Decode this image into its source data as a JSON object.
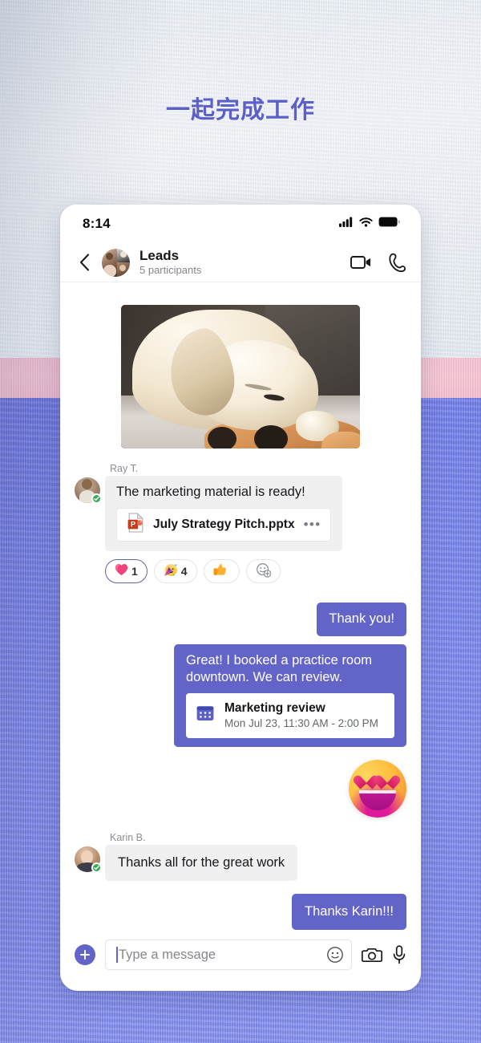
{
  "page": {
    "headline": "一起完成工作",
    "accent_color": "#5b5fc7",
    "bubble_out_color": "#6264c8",
    "background_bands": [
      "#e8ecf2",
      "#f3bfd0",
      "#7a86ea"
    ]
  },
  "statusbar": {
    "time": "8:14",
    "icons": [
      "cellular-signal-icon",
      "wifi-icon",
      "battery-icon"
    ]
  },
  "header": {
    "back_icon": "back-chevron-icon",
    "avatar": "group-avatar",
    "title": "Leads",
    "subtitle": "5 participants",
    "actions": [
      {
        "icon": "video-call-icon",
        "label": "Video call"
      },
      {
        "icon": "audio-call-icon",
        "label": "Audio call"
      }
    ]
  },
  "messages": [
    {
      "type": "photo",
      "name": "photo-message",
      "alt": "Sleeping yellow labrador resting on a plush toy"
    },
    {
      "type": "incoming",
      "sender": "Ray T.",
      "presence": "available",
      "text": "The marketing material is ready!",
      "attachment": {
        "icon": "powerpoint-file-icon",
        "name": "July Strategy Pitch.pptx",
        "more_label": "•••"
      },
      "reactions": [
        {
          "emoji": "❤️",
          "name": "heart-reaction",
          "count": "1",
          "selected": true
        },
        {
          "emoji": "🥳",
          "name": "party-face-reaction",
          "count": "4",
          "selected": false
        },
        {
          "emoji": "👍",
          "name": "thumbs-up-reaction",
          "count": "",
          "selected": false
        },
        {
          "emoji": "",
          "name": "add-reaction",
          "count": "",
          "selected": false
        }
      ]
    },
    {
      "type": "outgoing",
      "text": "Thank you!"
    },
    {
      "type": "outgoing",
      "text": "Great! I booked a practice room downtown. We can review.",
      "event": {
        "icon": "calendar-icon",
        "title": "Marketing review",
        "time": "Mon Jul 23, 11:30 AM - 2:00 PM"
      }
    },
    {
      "type": "sticker",
      "name": "heart-eyes-sticker",
      "emoji": "😍"
    },
    {
      "type": "incoming",
      "sender": "Karin B.",
      "presence": "available",
      "text": "Thanks all for the great work"
    },
    {
      "type": "outgoing",
      "text": "Thanks Karin!!!"
    }
  ],
  "composer": {
    "add_button_label": "+",
    "placeholder": "Type a message",
    "value": "",
    "icons": [
      "emoji-icon",
      "camera-icon",
      "microphone-icon"
    ]
  }
}
